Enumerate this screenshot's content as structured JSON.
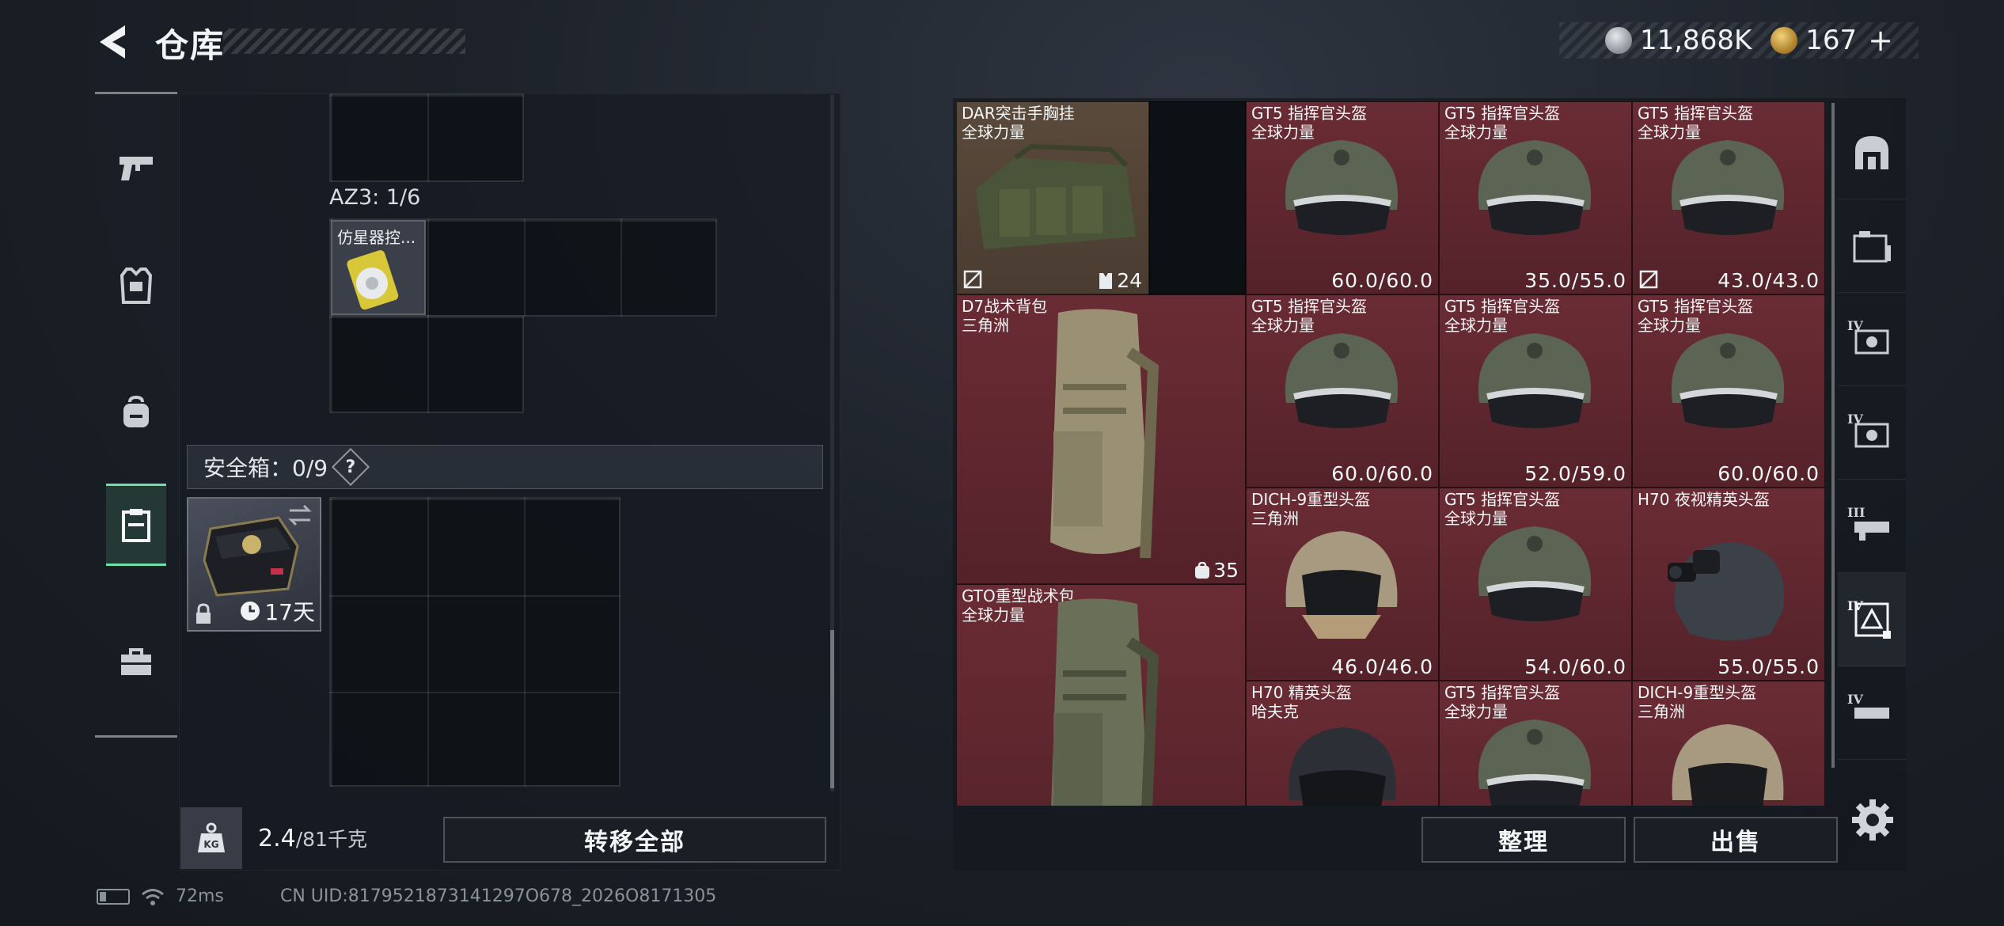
{
  "header": {
    "title": "仓库",
    "currency_silver": "11,868K",
    "currency_gold": "167",
    "plus": "+"
  },
  "left_rail": {
    "items": [
      "pistol-icon",
      "armor-icon",
      "backpack-icon",
      "safebox-icon",
      "toolbox-icon"
    ],
    "active_index": 3
  },
  "inventory": {
    "az3_label": "AZ3: 1/6",
    "az3_item_name": "仿星器控...",
    "safe_box": {
      "label": "安全箱：0/9",
      "help": "?",
      "days": "17天"
    },
    "weight_value": "2.4",
    "weight_max": "/81千克",
    "transfer_all": "转移全部"
  },
  "stash": {
    "items": [
      {
        "name": "DAR突击手胸挂",
        "sub": "全球力量",
        "count": "24",
        "color": "brown"
      },
      {
        "name": "GT5 指挥官头盔",
        "sub": "全球力量",
        "durability": "60.0/60.0",
        "color": "red"
      },
      {
        "name": "GT5 指挥官头盔",
        "sub": "全球力量",
        "durability": "35.0/55.0",
        "color": "red"
      },
      {
        "name": "GT5 指挥官头盔",
        "sub": "全球力量",
        "durability": "43.0/43.0",
        "color": "red"
      },
      {
        "name": "D7战术背包",
        "sub": "三角洲",
        "count": "35",
        "color": "red"
      },
      {
        "name": "GT5 指挥官头盔",
        "sub": "全球力量",
        "durability": "60.0/60.0",
        "color": "red"
      },
      {
        "name": "GT5 指挥官头盔",
        "sub": "全球力量",
        "durability": "52.0/59.0",
        "color": "red"
      },
      {
        "name": "GT5 指挥官头盔",
        "sub": "全球力量",
        "durability": "60.0/60.0",
        "color": "red"
      },
      {
        "name": "DICH-9重型头盔",
        "sub": "三角洲",
        "durability": "46.0/46.0",
        "color": "red"
      },
      {
        "name": "GT5 指挥官头盔",
        "sub": "全球力量",
        "durability": "54.0/60.0",
        "color": "red"
      },
      {
        "name": "H70 夜视精英头盔",
        "sub": "",
        "durability": "55.0/55.0",
        "color": "red"
      },
      {
        "name": "GTO重型战术包",
        "sub": "全球力量",
        "color": "red"
      },
      {
        "name": "H70 精英头盔",
        "sub": "哈夫克",
        "color": "red"
      },
      {
        "name": "GT5 指挥官头盔",
        "sub": "全球力量",
        "color": "red"
      },
      {
        "name": "DICH-9重型头盔",
        "sub": "三角洲",
        "color": "red"
      }
    ],
    "sort": "整理",
    "sell": "出售"
  },
  "right_rail": {
    "tiers": [
      "",
      "",
      "IV",
      "IV",
      "III",
      "IV",
      "IV"
    ]
  },
  "status": {
    "ping": "72ms",
    "uid": "CN UID:8179521873141297O678_2026O8171305"
  }
}
